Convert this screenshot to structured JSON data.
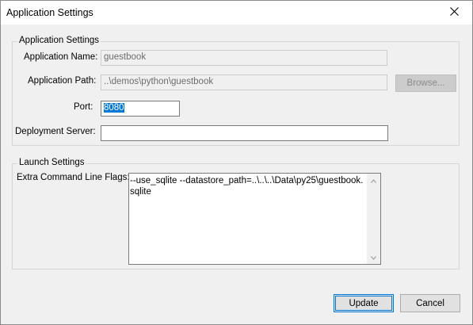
{
  "window": {
    "title": "Application Settings"
  },
  "app_group": {
    "legend": "Application Settings",
    "name_label": "Application Name:",
    "name_value": "guestbook",
    "path_label": "Application Path:",
    "path_value": "..\\demos\\python\\guestbook",
    "browse_label": "Browse...",
    "port_label": "Port:",
    "port_value": "8080",
    "server_label": "Deployment Server:",
    "server_value": ""
  },
  "launch_group": {
    "legend": "Launch Settings",
    "flags_label": "Extra Command Line Flags:",
    "flags_value": "--use_sqlite --datastore_path=..\\..\\..\\Data\\py25\\guestbook.sqlite"
  },
  "buttons": {
    "update": "Update",
    "cancel": "Cancel"
  },
  "icons": {
    "close": "close-icon",
    "scroll_up": "chevron-up-icon",
    "scroll_down": "chevron-down-icon"
  },
  "colors": {
    "selection": "#0078d7",
    "window_bg": "#f0f0f0"
  }
}
